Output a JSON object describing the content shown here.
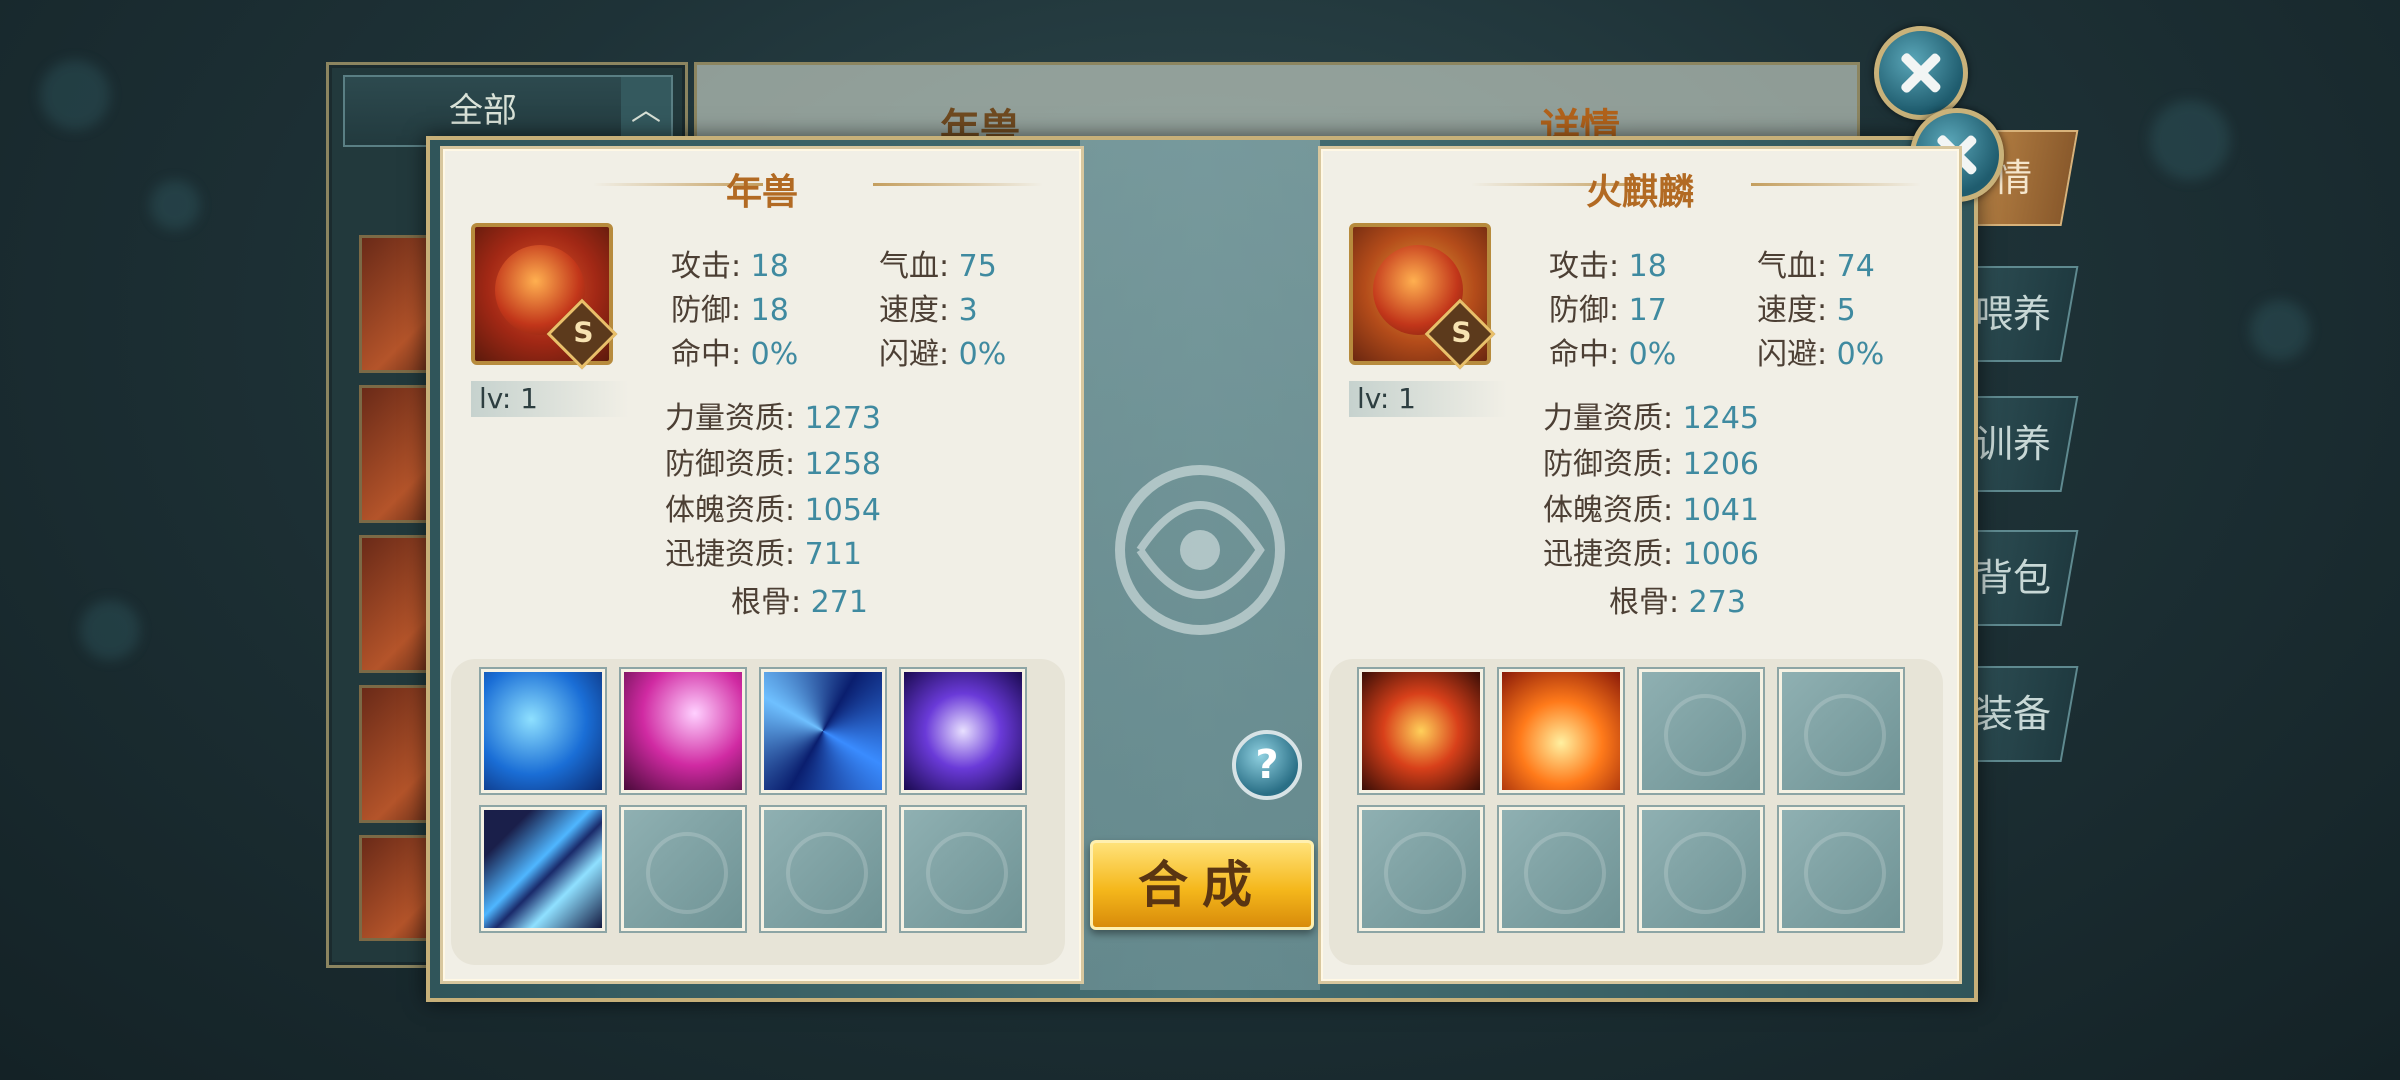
{
  "background": {
    "filter_label": "全部",
    "back_title": "年兽",
    "detail_title": "详情",
    "side_tabs": [
      "情",
      "喂养",
      "训养",
      "背包",
      "装备"
    ]
  },
  "left_card": {
    "name": "年兽",
    "rank": "S",
    "level": "lv: 1",
    "stats": {
      "attack_label": "攻击:",
      "attack": "18",
      "hp_label": "气血:",
      "hp": "75",
      "defense_label": "防御:",
      "defense": "18",
      "speed_label": "速度:",
      "speed": "3",
      "hit_label": "命中:",
      "hit": "0%",
      "dodge_label": "闪避:",
      "dodge": "0%"
    },
    "aptitudes": {
      "strength_label": "力量资质:",
      "strength": "1273",
      "defense_label": "防御资质:",
      "defense": "1258",
      "physique_label": "体魄资质:",
      "physique": "1054",
      "agility_label": "迅捷资质:",
      "agility": "711",
      "root_label": "根骨:",
      "root": "271"
    },
    "skills": [
      "ice-beast-skill-icon",
      "lightning-skill-icon",
      "vortex-skill-icon",
      "arcane-slash-skill-icon",
      "claw-skill-icon",
      "empty",
      "empty",
      "empty"
    ]
  },
  "right_card": {
    "name": "火麒麟",
    "rank": "S",
    "level": "lv: 1",
    "stats": {
      "attack_label": "攻击:",
      "attack": "18",
      "hp_label": "气血:",
      "hp": "74",
      "defense_label": "防御:",
      "defense": "17",
      "speed_label": "速度:",
      "speed": "5",
      "hit_label": "命中:",
      "hit": "0%",
      "dodge_label": "闪避:",
      "dodge": "0%"
    },
    "aptitudes": {
      "strength_label": "力量资质:",
      "strength": "1245",
      "defense_label": "防御资质:",
      "defense": "1206",
      "physique_label": "体魄资质:",
      "physique": "1041",
      "agility_label": "迅捷资质:",
      "agility": "1006",
      "root_label": "根骨:",
      "root": "273"
    },
    "skills": [
      "fireball-skill-icon",
      "flame-blast-skill-icon",
      "empty",
      "empty",
      "empty",
      "empty",
      "empty",
      "empty"
    ]
  },
  "buttons": {
    "help": "?",
    "combine": "合成"
  },
  "colors": {
    "accent_gold": "#c7b079",
    "title_orange": "#b26a23",
    "value_blue": "#3f8aa0",
    "combine_yellow": "#f5b81c"
  }
}
